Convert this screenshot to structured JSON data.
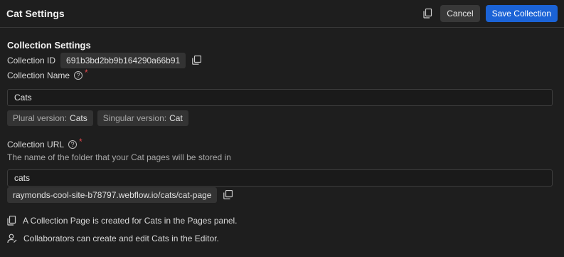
{
  "header": {
    "title": "Cat Settings",
    "cancel_label": "Cancel",
    "save_label": "Save Collection"
  },
  "section": {
    "title": "Collection Settings"
  },
  "collection_id": {
    "label": "Collection ID",
    "value": "691b3bd2bb9b164290a66b91"
  },
  "collection_name": {
    "label": "Collection Name",
    "required_mark": "*",
    "value": "Cats",
    "plural_label": "Plural version:",
    "plural_value": "Cats",
    "singular_label": "Singular version:",
    "singular_value": "Cat"
  },
  "collection_url": {
    "label": "Collection URL",
    "required_mark": "*",
    "description": "The name of the folder that your Cat pages will be stored in",
    "value": "cats",
    "full_url": "raymonds-cool-site-b78797.webflow.io/cats/cat-page"
  },
  "info": {
    "pages_note": "A Collection Page is created for Cats in the Pages panel.",
    "editor_note": "Collaborators can create and edit Cats in the Editor."
  },
  "colors": {
    "accent": "#1b63d6",
    "background": "#1e1e1e",
    "required": "#e5484d"
  },
  "icons": [
    "duplicate-icon",
    "copy-icon",
    "help-icon",
    "pages-icon",
    "collaborators-icon"
  ]
}
